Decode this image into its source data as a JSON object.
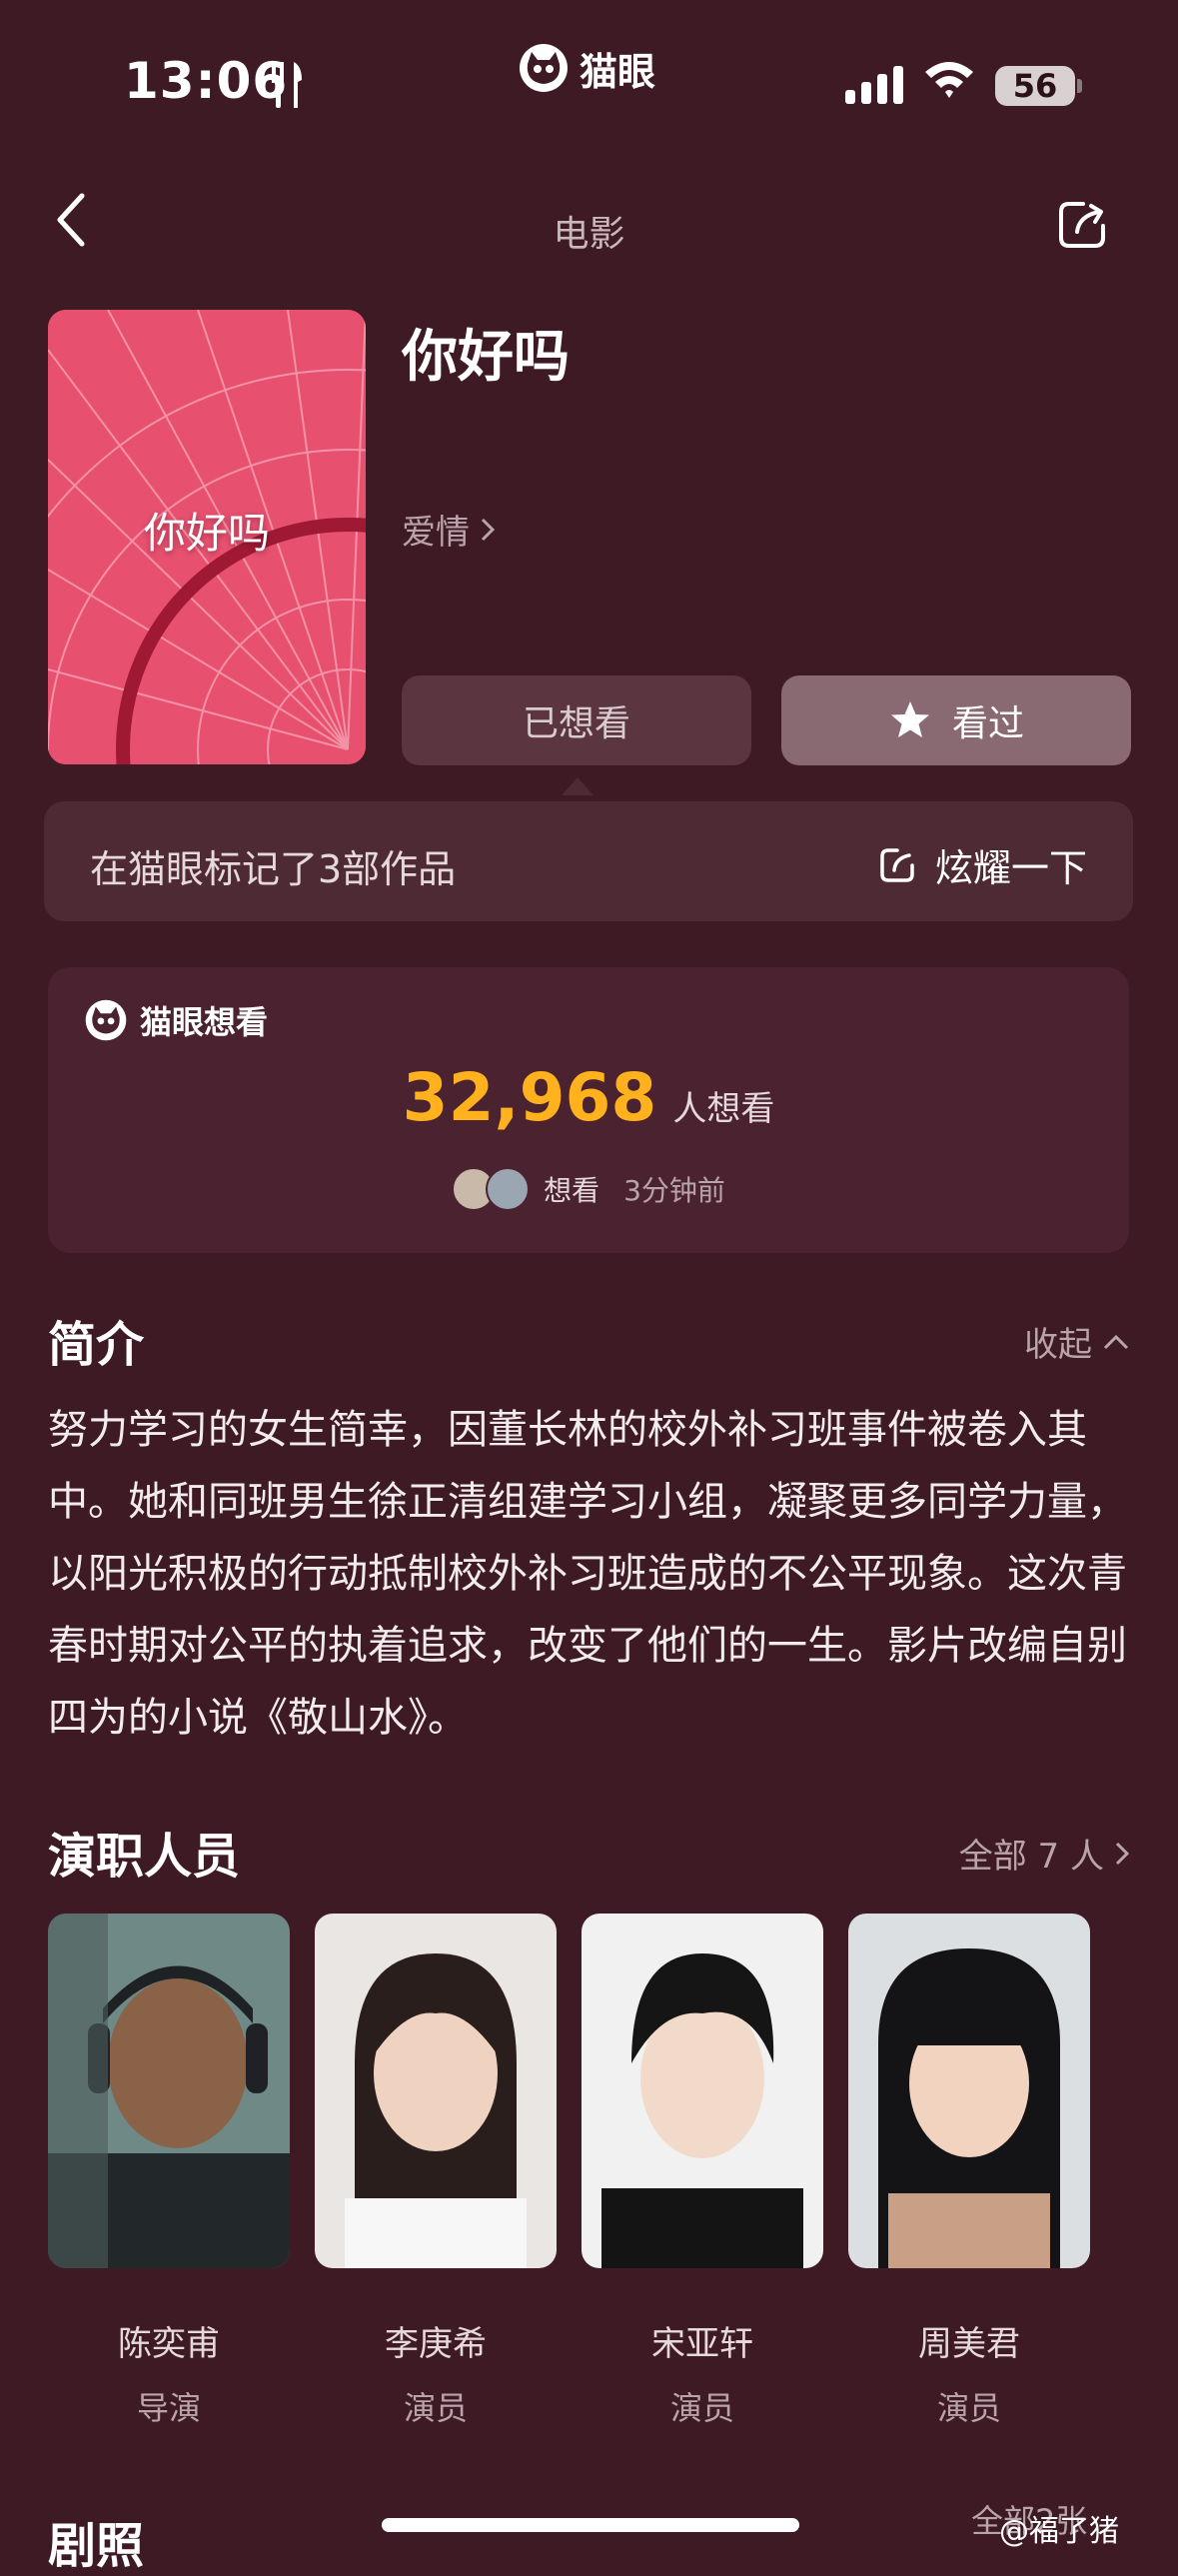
{
  "status": {
    "time": "13:06",
    "battery": "56"
  },
  "brand": {
    "name": "猫眼"
  },
  "nav": {
    "title": "电影"
  },
  "movie": {
    "title": "你好吗",
    "poster_text": "你好吗",
    "genre": "爱情",
    "want_label": "已想看",
    "seen_label": "看过"
  },
  "mark": {
    "text": "在猫眼标记了3部作品",
    "flaunt": "炫耀一下"
  },
  "want": {
    "header": "猫眼想看",
    "count": "32,968",
    "unit": "人想看",
    "recent_action": "想看",
    "recent_time": "3分钟前"
  },
  "intro": {
    "title": "简介",
    "collapse": "收起",
    "text": "努力学习的女生简幸，因董长林的校外补习班事件被卷入其中。她和同班男生徐正清组建学习小组，凝聚更多同学力量，以阳光积极的行动抵制校外补习班造成的不公平现象。这次青春时期对公平的执着追求，改变了他们的一生。影片改编自别四为的小说《敬山水》。"
  },
  "cast": {
    "title": "演职人员",
    "all": "全部 7 人",
    "members": [
      {
        "name": "陈奕甫",
        "role": "导演"
      },
      {
        "name": "李庚希",
        "role": "演员"
      },
      {
        "name": "宋亚轩",
        "role": "演员"
      },
      {
        "name": "周美君",
        "role": "演员"
      }
    ]
  },
  "photos": {
    "title": "剧照",
    "all": "全部2张"
  },
  "watermark": "@福了猪",
  "colors": {
    "background": "#3e1a25",
    "accent": "#ffb21e",
    "card": "#4a2230"
  }
}
